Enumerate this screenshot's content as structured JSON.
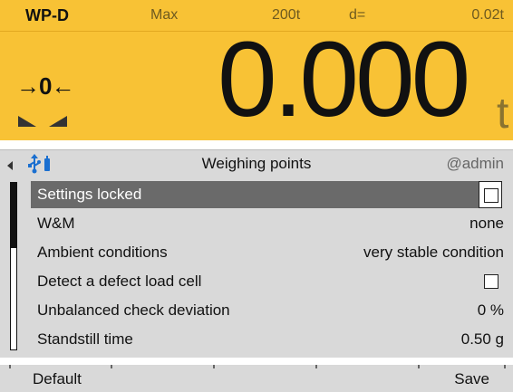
{
  "display": {
    "model": "WP-D",
    "max_label": "Max",
    "capacity": "200t",
    "d_label": "d=",
    "d_value": "0.02t",
    "zero_indicator": "→0←",
    "weight": "0.000",
    "unit": "t"
  },
  "titlebar": {
    "title": "Weighing points",
    "user": "@admin"
  },
  "list": {
    "items": [
      {
        "label": "Settings locked",
        "value": "",
        "checkbox": true,
        "checked": false,
        "selected": true
      },
      {
        "label": "W&M",
        "value": "none"
      },
      {
        "label": "Ambient conditions",
        "value": "very stable condition"
      },
      {
        "label": "Detect a defect load cell",
        "value": "",
        "checkbox": true,
        "checked": false
      },
      {
        "label": "Unbalanced check deviation",
        "value": "0 %"
      },
      {
        "label": "Standstill time",
        "value": "0.50 g"
      }
    ]
  },
  "softkeys": {
    "left": "Default",
    "right": "Save"
  },
  "colors": {
    "display_bg": "#f8c235",
    "panel_bg": "#d9d9d9",
    "selected_row": "#6a6a6a",
    "usb_icon": "#1a6fd0"
  }
}
